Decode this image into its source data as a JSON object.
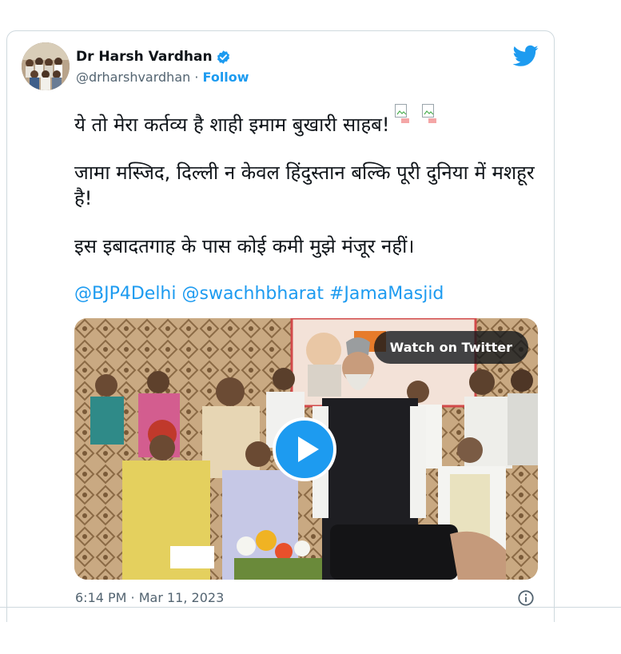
{
  "author": {
    "display_name": "Dr Harsh Vardhan",
    "handle": "@drharshvardhan",
    "separator": "·",
    "follow_label": "Follow"
  },
  "icons": {
    "verified": "verified-badge-icon",
    "logo": "twitter-bird-icon",
    "play": "play-icon",
    "info": "info-icon"
  },
  "tweet": {
    "line1": "ये तो मेरा कर्तव्य है शाही इमाम बुखारी साहब!",
    "para2": "जामा मस्जिद, दिल्ली न केवल हिंदुस्तान बल्कि पूरी दुनिया में मशहूर है!",
    "para3": "इस इबादतगाह के पास कोई कमी मुझे मंजूर नहीं।",
    "tags": [
      "@BJP4Delhi",
      "@swachhbharat",
      "#JamaMasjid"
    ]
  },
  "media": {
    "watch_label": "Watch on Twitter"
  },
  "footer": {
    "timestamp": "6:14 PM · Mar 11, 2023"
  },
  "colors": {
    "accent": "#1d9bf0",
    "text": "#0f1419",
    "muted": "#536471",
    "border": "#cfd9de"
  }
}
